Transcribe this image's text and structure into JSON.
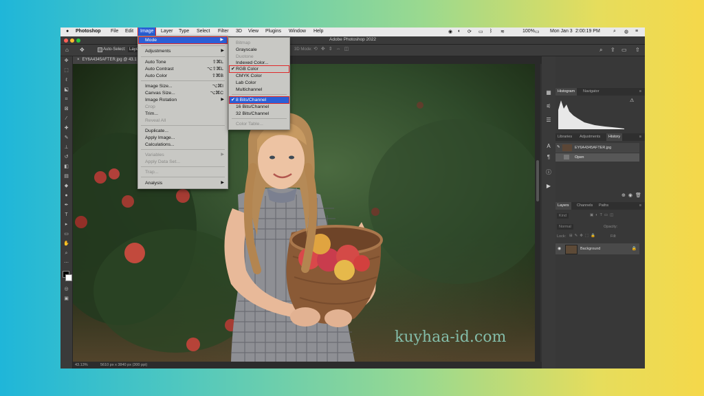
{
  "macbar": {
    "app": "Photoshop",
    "items": [
      "File",
      "Edit",
      "Image",
      "Layer",
      "Type",
      "Select",
      "Filter",
      "3D",
      "View",
      "Plugins",
      "Window",
      "Help"
    ],
    "battery": "100%",
    "date": "Mon Jan 3",
    "time": "2:00:19 PM"
  },
  "window": {
    "title": "Adobe Photoshop 2022"
  },
  "options": {
    "auto_select": "Auto-Select:",
    "layer": "Layer",
    "mode3d": "3D Mode:"
  },
  "document": {
    "tab": "EY6A4345AFTER.jpg @ 43.1",
    "zoom": "43.13%",
    "info": "5610 px x 3840 px (300 ppi)"
  },
  "image_menu": {
    "mode": "Mode",
    "adjustments": "Adjustments",
    "auto_tone": "Auto Tone",
    "auto_tone_sc": "⇧⌘L",
    "auto_contrast": "Auto Contrast",
    "auto_contrast_sc": "⌥⇧⌘L",
    "auto_color": "Auto Color",
    "auto_color_sc": "⇧⌘B",
    "image_size": "Image Size...",
    "image_size_sc": "⌥⌘I",
    "canvas_size": "Canvas Size...",
    "canvas_size_sc": "⌥⌘C",
    "image_rotation": "Image Rotation",
    "crop": "Crop",
    "trim": "Trim...",
    "reveal_all": "Reveal All",
    "duplicate": "Duplicate...",
    "apply_image": "Apply Image...",
    "calculations": "Calculations...",
    "variables": "Variables",
    "apply_data_set": "Apply Data Set...",
    "trap": "Trap...",
    "analysis": "Analysis"
  },
  "mode_menu": {
    "bitmap": "Bitmap",
    "grayscale": "Grayscale",
    "duotone": "Duotone",
    "indexed": "Indexed Color...",
    "rgb": "RGB Color",
    "cmyk": "CMYK Color",
    "lab": "Lab Color",
    "multichannel": "Multichannel",
    "bits8": "8 Bits/Channel",
    "bits16": "16 Bits/Channel",
    "bits32": "32 Bits/Channel",
    "color_table": "Color Table..."
  },
  "panels": {
    "histogram_tab": "Histogram",
    "navigator_tab": "Navigator",
    "libraries_tab": "Libraries",
    "adjustments_tab": "Adjustments",
    "history_tab": "History",
    "history_doc": "EY6A4345AFTER.jpg",
    "history_open": "Open",
    "layers_tab": "Layers",
    "channels_tab": "Channels",
    "paths_tab": "Paths",
    "kind": "Kind",
    "blend": "Normal",
    "opacity": "Opacity:",
    "lock": "Lock:",
    "fill": "Fill:",
    "layer_name": "Background"
  },
  "watermark": "kuyhaa-id.com",
  "colors": {
    "menu_highlight": "#2b5fd6",
    "annotation_red": "#e02828"
  }
}
